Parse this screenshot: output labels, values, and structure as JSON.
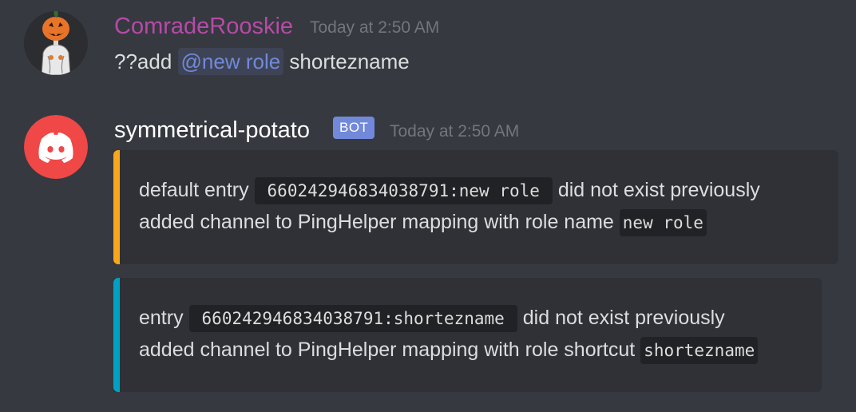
{
  "messages": [
    {
      "author": "ComradeRooskie",
      "author_color": "#b74aa8",
      "timestamp": "Today at 2:50 AM",
      "avatar_icon": "pumpkin-head-icon",
      "content": {
        "prefix": "??add ",
        "mention": "@new role",
        "suffix": " shortezname"
      }
    },
    {
      "author": "symmetrical-potato",
      "author_color": "#ffffff",
      "tag": "BOT",
      "timestamp": "Today at 2:50 AM",
      "avatar_icon": "discord-logo-icon",
      "avatar_color": "#f04747",
      "embeds": [
        {
          "bar_color": "#faa61a",
          "line1_prefix": "default entry ",
          "line1_code": "660242946834038791:new role",
          "line1_suffix": " did not exist previously",
          "line2_prefix": "added channel to PingHelper mapping with role name ",
          "line2_code": "new role"
        },
        {
          "bar_color": "#00a2c4",
          "line1_prefix": "entry ",
          "line1_code": "660242946834038791:shortezname",
          "line1_suffix": " did not exist previously",
          "line2_prefix": "added channel to PingHelper mapping with role shortcut ",
          "line2_code": "shortezname"
        }
      ]
    }
  ]
}
